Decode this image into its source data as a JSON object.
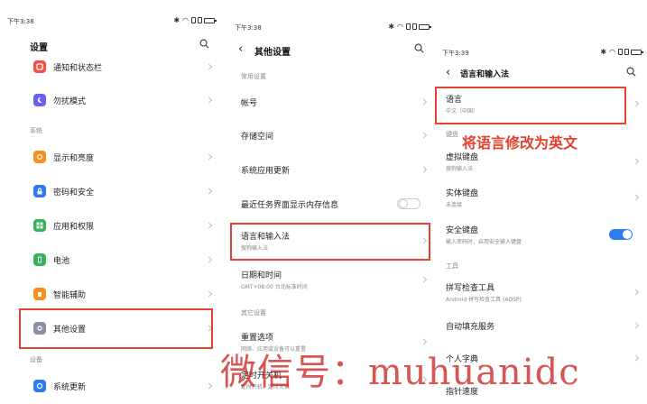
{
  "colors": {
    "annotation_red": "#e5402d",
    "toggle_on": "#2f7bf0",
    "watermark": "#c81e1e",
    "icon_notify": "#f25248",
    "icon_dnd": "#6b5ef0",
    "icon_display": "#f6901e",
    "icon_password": "#2f7bf0",
    "icon_apps": "#33b35a",
    "icon_battery": "#33b35a",
    "icon_assist": "#f6901e",
    "icon_other": "#8a93a6",
    "icon_update": "#2f7bf0"
  },
  "panel1": {
    "status_time": "下午3:38",
    "title": "设置",
    "section_system": "系统",
    "section_device": "设备",
    "items": [
      {
        "label": "通知和状态栏",
        "icon": "bell-icon"
      },
      {
        "label": "勿扰模式",
        "icon": "moon-icon"
      },
      {
        "label": "显示和亮度",
        "icon": "sun-icon"
      },
      {
        "label": "密码和安全",
        "icon": "lock-icon"
      },
      {
        "label": "应用和权限",
        "icon": "grid-icon"
      },
      {
        "label": "电池",
        "icon": "battery-icon"
      },
      {
        "label": "智能辅助",
        "icon": "hand-icon"
      },
      {
        "label": "其他设置",
        "icon": "more-icon"
      },
      {
        "label": "系统更新",
        "icon": "refresh-icon"
      }
    ]
  },
  "panel2": {
    "status_time": "下午3:38",
    "title": "其他设置",
    "section_common": "常用设置",
    "section_other": "其它设置",
    "items": [
      {
        "label": "帐号",
        "sub": ""
      },
      {
        "label": "存储空间",
        "sub": ""
      },
      {
        "label": "系统应用更新",
        "sub": ""
      },
      {
        "label": "最近任务界面显示内存信息",
        "sub": ""
      },
      {
        "label": "语言和输入法",
        "sub": "搜狗输入法"
      },
      {
        "label": "日期和时间",
        "sub": "GMT+08:00 台北标准时间"
      },
      {
        "label": "重置选项",
        "sub": "网络、应用或设备可以重置"
      },
      {
        "label": "定时开关机",
        "sub": "定时开机、定时关机"
      }
    ]
  },
  "panel3": {
    "status_time": "下午3:39",
    "title": "语言和输入法",
    "section_keyboard": "键盘",
    "section_tools": "工具",
    "items": [
      {
        "label": "语言",
        "sub": "中文（中国）"
      },
      {
        "label": "虚拟键盘",
        "sub": "搜狗输入法"
      },
      {
        "label": "实体键盘",
        "sub": "未连接"
      },
      {
        "label": "安全键盘",
        "sub": "输入密码时，启用安全输入键盘"
      },
      {
        "label": "拼写检查工具",
        "sub": "Android 拼写检查工具 (AOSP)"
      },
      {
        "label": "自动填充服务",
        "sub": ""
      },
      {
        "label": "个人字典",
        "sub": ""
      },
      {
        "label": "指针速度",
        "sub": ""
      }
    ]
  },
  "annotation": "将语言修改为英文",
  "watermark": "微信号：muhuanidc"
}
